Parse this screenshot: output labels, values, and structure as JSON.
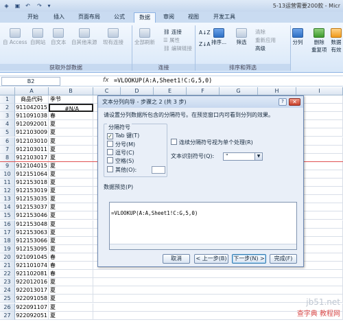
{
  "window": {
    "title": "5-13运营需要200款 - Micr"
  },
  "tabs": [
    {
      "label": "开始"
    },
    {
      "label": "插入"
    },
    {
      "label": "页面布局"
    },
    {
      "label": "公式"
    },
    {
      "label": "数据",
      "active": true
    },
    {
      "label": "审阅"
    },
    {
      "label": "视图"
    },
    {
      "label": "开发工具"
    }
  ],
  "ribbon": {
    "external": {
      "buttons": [
        "自 Access",
        "自网站",
        "自文本",
        "自其他来源",
        "现有连接"
      ],
      "title": "获取外部数据"
    },
    "connections": {
      "refresh": "全部刷新",
      "links": [
        "连接",
        "属性",
        "编辑链接"
      ],
      "title": "连接"
    },
    "sort": {
      "az": "A↓Z",
      "za": "Z↓A",
      "sort": "排序...",
      "filter": "筛选",
      "side": [
        "清除",
        "重新应用",
        "高级"
      ],
      "title": "排序和筛选"
    },
    "tools": {
      "split": "分列",
      "remove_dup": "删除\n重复项",
      "validity": "数据\n有效"
    }
  },
  "formula_bar": {
    "cell": "B2",
    "fx": "fx",
    "formula": "=VLOOKUP(A:A,Sheet1!C:G,5,0)"
  },
  "columns": [
    "A",
    "B",
    "C",
    "D",
    "E",
    "F",
    "G",
    "H",
    "I"
  ],
  "rows": [
    {
      "n": "1",
      "a": "商品代码",
      "b": "季节"
    },
    {
      "n": "2",
      "a": "911042015",
      "b": "#N/A"
    },
    {
      "n": "3",
      "a": "911091038",
      "b": "春"
    },
    {
      "n": "4",
      "a": "912092001",
      "b": "夏"
    },
    {
      "n": "5",
      "a": "912103009",
      "b": "夏"
    },
    {
      "n": "6",
      "a": "912103010",
      "b": "夏"
    },
    {
      "n": "7",
      "a": "912103011",
      "b": "夏"
    },
    {
      "n": "8",
      "a": "912103017",
      "b": "夏"
    },
    {
      "n": "9",
      "a": "912104015",
      "b": "夏"
    },
    {
      "n": "10",
      "a": "912151064",
      "b": "夏"
    },
    {
      "n": "11",
      "a": "912153018",
      "b": "夏"
    },
    {
      "n": "12",
      "a": "912153019",
      "b": "夏"
    },
    {
      "n": "13",
      "a": "912153035",
      "b": "夏"
    },
    {
      "n": "14",
      "a": "912153037",
      "b": "夏"
    },
    {
      "n": "15",
      "a": "912153046",
      "b": "夏"
    },
    {
      "n": "16",
      "a": "912153048",
      "b": "夏"
    },
    {
      "n": "17",
      "a": "912153063",
      "b": "夏"
    },
    {
      "n": "18",
      "a": "912153066",
      "b": "夏"
    },
    {
      "n": "19",
      "a": "912153095",
      "b": "夏"
    },
    {
      "n": "20",
      "a": "921091045",
      "b": "春"
    },
    {
      "n": "21",
      "a": "921101074",
      "b": "春"
    },
    {
      "n": "22",
      "a": "921102081",
      "b": "春"
    },
    {
      "n": "23",
      "a": "922012016",
      "b": "夏"
    },
    {
      "n": "24",
      "a": "922013017",
      "b": "夏"
    },
    {
      "n": "25",
      "a": "922091058",
      "b": "夏"
    },
    {
      "n": "26",
      "a": "922091107",
      "b": "夏"
    },
    {
      "n": "27",
      "a": "922092051",
      "b": "夏"
    }
  ],
  "dialog": {
    "title": "文本分列向导 - 步骤之 2 (共 3 步)",
    "help": "?",
    "close": "✕",
    "instruction": "请设置分列数据所包含的分隔符号。在预览窗口内可看到分列的效果。",
    "delimiters_title": "分隔符号",
    "delimiters": [
      {
        "label": "Tab 键(T)",
        "checked": true
      },
      {
        "label": "分号(M)",
        "checked": false
      },
      {
        "label": "逗号(C)",
        "checked": false
      },
      {
        "label": "空格(S)",
        "checked": false
      },
      {
        "label": "其他(O):",
        "checked": false
      }
    ],
    "consecutive": "连续分隔符号视为单个处理(R)",
    "qualifier_label": "文本识别符号(Q):",
    "qualifier_value": "\"",
    "preview_title": "数据预览(P)",
    "preview_text": "=VLOOKUP(A:A,Sheet1!C:G,5,0)",
    "buttons": {
      "cancel": "取消",
      "back": "< 上一步(B)",
      "next": "下一步(N) >",
      "finish": "完成(F)"
    }
  },
  "watermark": {
    "line1": "jb51.net",
    "line2": "查字典 教程网"
  }
}
